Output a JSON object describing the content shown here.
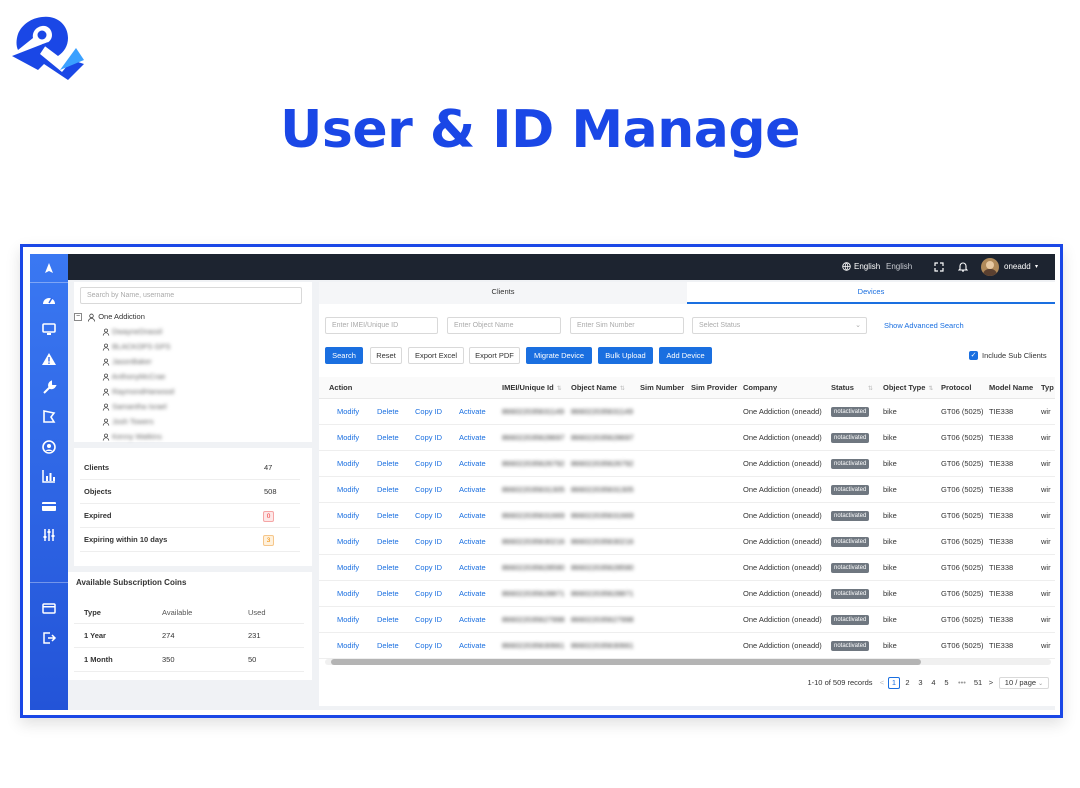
{
  "headline": "User & ID Manage",
  "colors": {
    "brand": "#1a47e6",
    "primary": "#1a6fe0",
    "topbar": "#1d2430",
    "rail": "#2f66e8",
    "status_pill": "#6f7780"
  },
  "topbar": {
    "language_current": "English",
    "language_option": "English",
    "username": "oneadd",
    "icons": [
      "globe-icon",
      "fullscreen-icon",
      "bell-icon",
      "avatar",
      "caret-down-icon"
    ]
  },
  "rail_icons": [
    "nav-arrow-icon",
    "dashboard-icon",
    "monitor-icon",
    "alert-icon",
    "wrench-icon",
    "geofence-icon",
    "user-circle-icon",
    "chart-icon",
    "card-icon",
    "sliders-icon",
    "wallet-icon",
    "logout-icon"
  ],
  "left": {
    "search_placeholder": "Search by Name, username",
    "tree_root": "One Addiction",
    "tree_children": [
      "DwayneDrassil",
      "BLACKOPS GPS",
      "JasonBaker",
      "AnthonyMcCrae",
      "RaymondHarwood",
      "Samantha Israel",
      "Josh Towers",
      "Kenny Watkins"
    ],
    "stats": [
      {
        "label": "Clients",
        "value": "47"
      },
      {
        "label": "Objects",
        "value": "508"
      },
      {
        "label": "Expired",
        "value": "0"
      },
      {
        "label": "Expiring within 10 days",
        "value": "3"
      }
    ],
    "coins": {
      "title": "Available Subscription Coins",
      "headers": [
        "Type",
        "Available",
        "Used"
      ],
      "rows": [
        [
          "1 Year",
          "274",
          "231"
        ],
        [
          "1 Month",
          "350",
          "50"
        ]
      ]
    }
  },
  "tabs": [
    "Clients",
    "Devices"
  ],
  "filters": {
    "imei_placeholder": "Enter IMEI/Unique ID",
    "object_placeholder": "Enter Object Name",
    "sim_placeholder": "Enter Sim Number",
    "status_placeholder": "Select Status",
    "advanced_link": "Show Advanced Search"
  },
  "buttons": [
    "Search",
    "Reset",
    "Export Excel",
    "Export PDF",
    "Migrate Device",
    "Bulk Upload",
    "Add Device"
  ],
  "include_sub_clients": "Include Sub Clients",
  "table": {
    "headers": [
      "Action",
      "IMEI/Unique Id",
      "Object Name",
      "Sim Number",
      "Sim Provider",
      "Company",
      "Status",
      "Object Type",
      "Protocol",
      "Model Name",
      "Typ"
    ],
    "actions": [
      "Modify",
      "Delete",
      "Copy ID",
      "Activate"
    ],
    "rows": [
      [
        "866022035631149",
        "866022035631149",
        "One Addiction (oneadd)",
        "notactivated",
        "bike",
        "GT06 (5025)",
        "TIE338",
        "wir"
      ],
      [
        "866022035628697",
        "866022035628697",
        "One Addiction (oneadd)",
        "notactivated",
        "bike",
        "GT06 (5025)",
        "TIE338",
        "wir"
      ],
      [
        "866022035626792",
        "866022035626792",
        "One Addiction (oneadd)",
        "notactivated",
        "bike",
        "GT06 (5025)",
        "TIE338",
        "wir"
      ],
      [
        "866022035631305",
        "866022035631305",
        "One Addiction (oneadd)",
        "notactivated",
        "bike",
        "GT06 (5025)",
        "TIE338",
        "wir"
      ],
      [
        "866022035631669",
        "866022035631669",
        "One Addiction (oneadd)",
        "notactivated",
        "bike",
        "GT06 (5025)",
        "TIE338",
        "wir"
      ],
      [
        "866022035630216",
        "866022035630216",
        "One Addiction (oneadd)",
        "notactivated",
        "bike",
        "GT06 (5025)",
        "TIE338",
        "wir"
      ],
      [
        "866022035628590",
        "866022035628590",
        "One Addiction (oneadd)",
        "notactivated",
        "bike",
        "GT06 (5025)",
        "TIE338",
        "wir"
      ],
      [
        "866022035628871",
        "866022035628871",
        "One Addiction (oneadd)",
        "notactivated",
        "bike",
        "GT06 (5025)",
        "TIE338",
        "wir"
      ],
      [
        "866022035627998",
        "866022035627998",
        "One Addiction (oneadd)",
        "notactivated",
        "bike",
        "GT06 (5025)",
        "TIE338",
        "wir"
      ],
      [
        "866022035630661",
        "866022035630661",
        "One Addiction (oneadd)",
        "notactivated",
        "bike",
        "GT06 (5025)",
        "TIE338",
        "wir"
      ]
    ]
  },
  "pagination": {
    "summary": "1-10 of 509 records",
    "prev": "<",
    "pages": [
      "1",
      "2",
      "3",
      "4",
      "5"
    ],
    "ellipsis": "•••",
    "last": "51",
    "next": ">",
    "page_size": "10 / page",
    "current": "1"
  }
}
